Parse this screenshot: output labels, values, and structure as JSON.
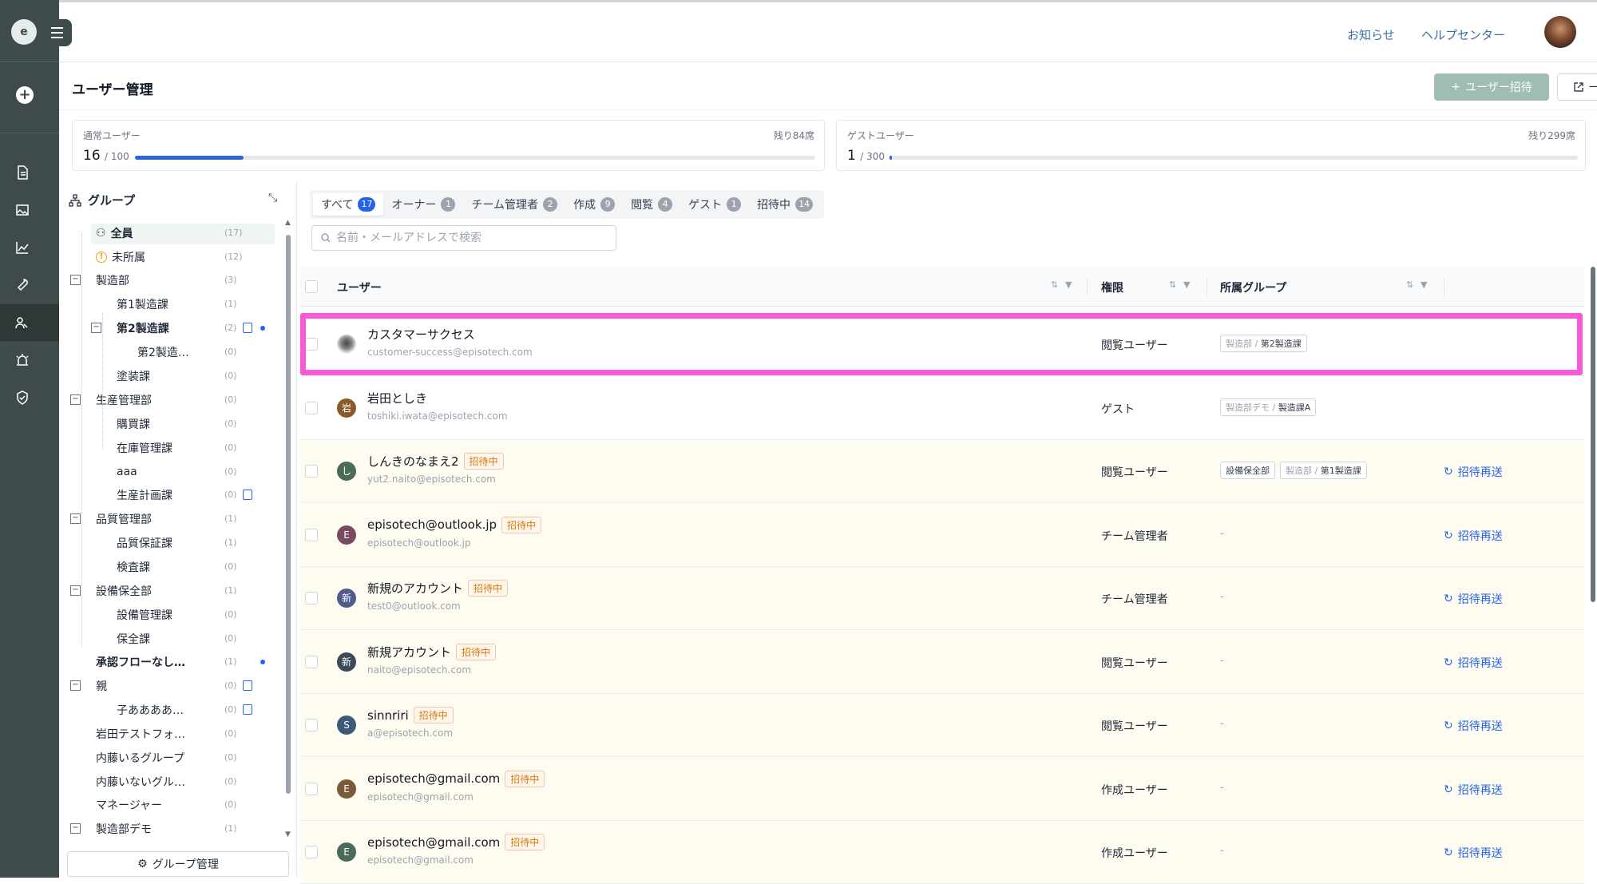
{
  "app": {
    "logo_text": "e"
  },
  "topbar": {
    "news": "お知らせ",
    "help": "ヘルプセンター"
  },
  "page": {
    "title": "ユーザー管理",
    "invite_button": "ユーザー招待",
    "bulk_button": "一括変更"
  },
  "quota": {
    "regular": {
      "label": "通常ユーザー",
      "used": "16",
      "total": "/ 100",
      "rest": "残り84席",
      "fill": 0.16
    },
    "guest": {
      "label": "ゲストユーザー",
      "used": "1",
      "total": "/ 300",
      "rest": "残り299席",
      "fill": 0.0033
    }
  },
  "groups": {
    "title": "グループ",
    "manage_button": "グループ管理",
    "items": [
      {
        "label": "全員",
        "count": "(17)"
      },
      {
        "label": "未所属",
        "count": "(12)"
      },
      {
        "label": "製造部",
        "count": "(3)"
      },
      {
        "label": "第1製造課",
        "count": "(1)"
      },
      {
        "label": "第2製造課",
        "count": "(2)"
      },
      {
        "label": "第2製造…",
        "count": "(0)"
      },
      {
        "label": "塗装課",
        "count": "(0)"
      },
      {
        "label": "生産管理部",
        "count": "(0)"
      },
      {
        "label": "購買課",
        "count": "(0)"
      },
      {
        "label": "在庫管理課",
        "count": "(0)"
      },
      {
        "label": "aaa",
        "count": "(0)"
      },
      {
        "label": "生産計画課",
        "count": "(0)"
      },
      {
        "label": "品質管理部",
        "count": "(1)"
      },
      {
        "label": "品質保証課",
        "count": "(1)"
      },
      {
        "label": "検査課",
        "count": "(0)"
      },
      {
        "label": "設備保全部",
        "count": "(1)"
      },
      {
        "label": "設備管理課",
        "count": "(0)"
      },
      {
        "label": "保全課",
        "count": "(0)"
      },
      {
        "label": "承認フローなし…",
        "count": "(1)"
      },
      {
        "label": "親",
        "count": "(0)"
      },
      {
        "label": "子ああああ…",
        "count": "(0)"
      },
      {
        "label": "岩田テストフォ…",
        "count": "(0)"
      },
      {
        "label": "内藤いるグループ",
        "count": "(0)"
      },
      {
        "label": "内藤いないグル…",
        "count": "(0)"
      },
      {
        "label": "マネージャー",
        "count": "(0)"
      },
      {
        "label": "製造部デモ",
        "count": "(1)"
      }
    ]
  },
  "tabs": [
    {
      "label": "すべて",
      "count": "17"
    },
    {
      "label": "オーナー",
      "count": "1"
    },
    {
      "label": "チーム管理者",
      "count": "2"
    },
    {
      "label": "作成",
      "count": "9"
    },
    {
      "label": "閲覧",
      "count": "4"
    },
    {
      "label": "ゲスト",
      "count": "1"
    },
    {
      "label": "招待中",
      "count": "14"
    }
  ],
  "search": {
    "placeholder": "名前・メールアドレスで検索"
  },
  "table": {
    "headers": {
      "user": "ユーザー",
      "role": "権限",
      "group": "所属グループ"
    },
    "pending_label": "招待中",
    "resend_label": "招待再送",
    "dash": "-",
    "rows": [
      {
        "avatar": "",
        "name": "カスタマーサクセス",
        "email": "customer-success@episotech.com",
        "role": "閲覧ユーザー",
        "groups": [
          {
            "parent": "製造部",
            "name": "第2製造課"
          }
        ],
        "pending": false
      },
      {
        "avatar": "岩",
        "name": "岩田としき",
        "email": "toshiki.iwata@episotech.com",
        "role": "ゲスト",
        "groups": [
          {
            "parent": "製造部デモ",
            "name": "製造課A"
          }
        ],
        "pending": false
      },
      {
        "avatar": "し",
        "name": "しんきのなまえ2",
        "email": "yut2.naito@episotech.com",
        "role": "閲覧ユーザー",
        "groups": [
          {
            "parent": "",
            "name": "設備保全部"
          },
          {
            "parent": "製造部",
            "name": "第1製造課"
          }
        ],
        "pending": true
      },
      {
        "avatar": "E",
        "name": "episotech@outlook.jp",
        "email": "episotech@outlook.jp",
        "role": "チーム管理者",
        "groups": [],
        "pending": true
      },
      {
        "avatar": "新",
        "name": "新規のアカウント",
        "email": "test0@outlook.com",
        "role": "チーム管理者",
        "groups": [],
        "pending": true
      },
      {
        "avatar": "新",
        "name": "新規アカウント",
        "email": "naito@episotech.com",
        "role": "閲覧ユーザー",
        "groups": [],
        "pending": true
      },
      {
        "avatar": "S",
        "name": "sinnriri",
        "email": "a@episotech.com",
        "role": "閲覧ユーザー",
        "groups": [],
        "pending": true
      },
      {
        "avatar": "E",
        "name": "episotech@gmail.com",
        "email": "episotech@gmail.com",
        "role": "作成ユーザー",
        "groups": [],
        "pending": true
      },
      {
        "avatar": "E",
        "name": "episotech@gmail.com",
        "email": "episotech@gmail.com",
        "role": "作成ユーザー",
        "groups": [],
        "pending": true
      }
    ]
  },
  "colors": {
    "accent": "#2563eb",
    "rail": "#3f4b4a",
    "highlight": "#f65ad8",
    "pending": "#d97706"
  }
}
